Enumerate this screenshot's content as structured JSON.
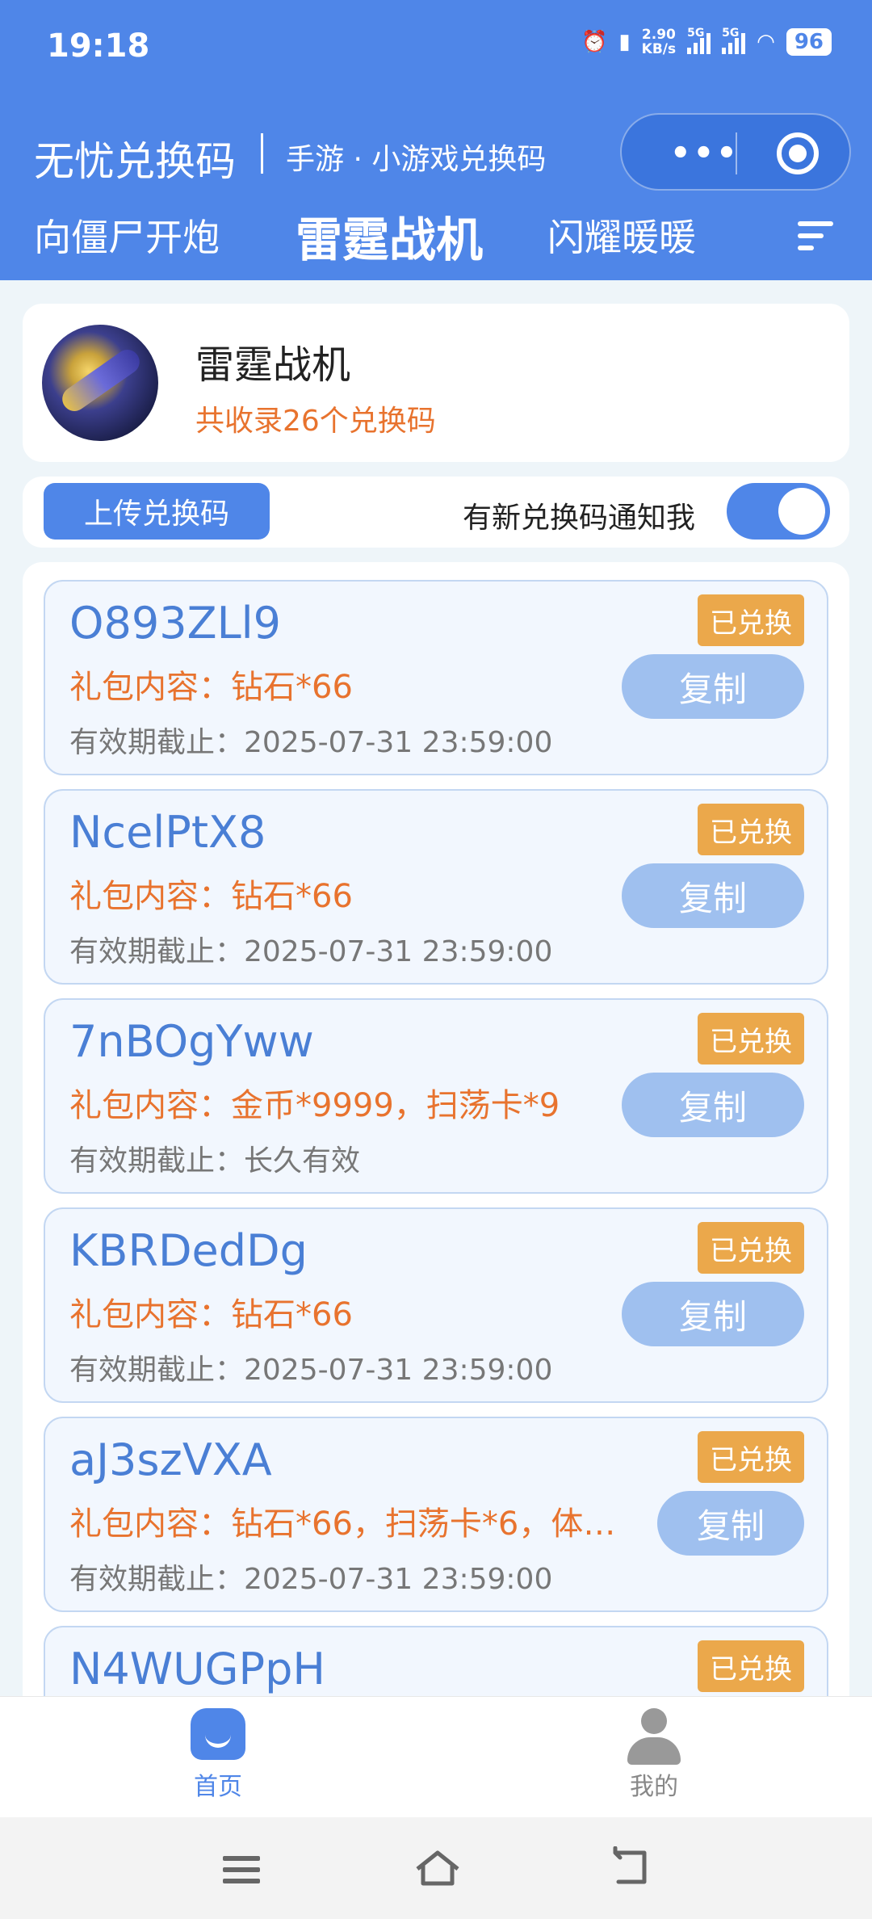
{
  "status_bar": {
    "time": "19:18",
    "speed_value": "2.90",
    "speed_unit": "KB/s",
    "net1": "5G",
    "net2": "5G",
    "battery": "96"
  },
  "app": {
    "title": "无忧兑换码",
    "subtitle": "手游 · 小游戏兑换码"
  },
  "capsule": {
    "more_icon": "more-dots-icon",
    "close_icon": "target-circle-icon"
  },
  "tabs": [
    {
      "label": "向僵尸开炮",
      "active": false
    },
    {
      "label": "雷霆战机",
      "active": true
    },
    {
      "label": "闪耀暖暖",
      "active": false
    }
  ],
  "tabs_menu_icon": "menu-lines-icon",
  "game": {
    "name": "雷霆战机",
    "count_text": "共收录26个兑换码"
  },
  "actions": {
    "upload_label": "上传兑换码",
    "notify_label": "有新兑换码通知我",
    "notify_on": true
  },
  "codes": [
    {
      "code": "O893ZLl9",
      "gift": "礼包内容：钻石*66",
      "expiry": "有效期截止：2025-07-31 23:59:00",
      "status": "已兑换",
      "copy": "复制"
    },
    {
      "code": "NcelPtX8",
      "gift": "礼包内容：钻石*66",
      "expiry": "有效期截止：2025-07-31 23:59:00",
      "status": "已兑换",
      "copy": "复制"
    },
    {
      "code": "7nBOgYww",
      "gift": "礼包内容：金币*9999，扫荡卡*9",
      "expiry": "有效期截止：长久有效",
      "status": "已兑换",
      "copy": "复制"
    },
    {
      "code": "KBRDedDg",
      "gift": "礼包内容：钻石*66",
      "expiry": "有效期截止：2025-07-31 23:59:00",
      "status": "已兑换",
      "copy": "复制"
    },
    {
      "code": "aJ3szVXA",
      "gift": "礼包内容：钻石*66，扫荡卡*6，体…",
      "expiry": "有效期截止：2025-07-31 23:59:00",
      "status": "已兑换",
      "copy": "复制"
    },
    {
      "code": "N4WUGPpH",
      "gift": "",
      "expiry": "",
      "status": "已兑换",
      "copy": ""
    }
  ],
  "bottom_nav": [
    {
      "label": "首页",
      "icon": "home-icon",
      "active": true
    },
    {
      "label": "我的",
      "icon": "user-icon",
      "active": false
    }
  ],
  "colors": {
    "primary": "#4f86e8",
    "accent_orange": "#e8732e",
    "badge": "#eba84b",
    "copy_button": "#9fc0ef"
  }
}
